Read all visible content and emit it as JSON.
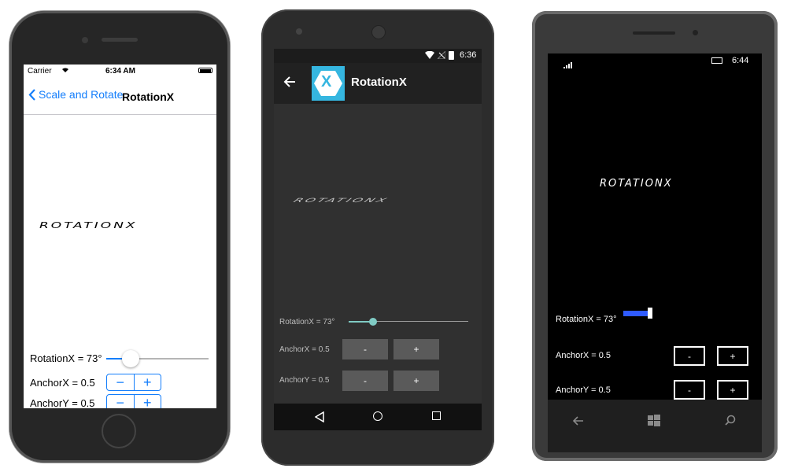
{
  "ios": {
    "status": {
      "carrier": "Carrier",
      "time": "6:34 AM"
    },
    "nav": {
      "back_label": "Scale and Rotate",
      "title": "RotationX"
    },
    "display_word": "ROTATIONX",
    "rotation_label": "RotationX = 73°",
    "anchor_x_label": "AnchorX = 0.5",
    "anchor_y_label": "AnchorY = 0.5",
    "minus": "−",
    "plus": "+",
    "slider_fraction": 0.2
  },
  "android": {
    "status": {
      "time": "6:36"
    },
    "title": "RotationX",
    "app_icon_letter": "X",
    "display_word": "ROTATIONX",
    "rotation_label": "RotationX = 73°",
    "anchor_x_label": "AnchorX = 0.5",
    "anchor_y_label": "AnchorY = 0.5",
    "minus": "-",
    "plus": "+",
    "slider_fraction": 0.2,
    "accent_color": "#80cbc4"
  },
  "windows": {
    "status": {
      "time": "6:44"
    },
    "display_word": "ROTATIONX",
    "rotation_label": "RotationX = 73°",
    "anchor_x_label": "AnchorX = 0.5",
    "anchor_y_label": "AnchorY = 0.5",
    "minus": "-",
    "plus": "+",
    "slider_fraction": 0.2,
    "accent_color": "#2f5bff"
  }
}
